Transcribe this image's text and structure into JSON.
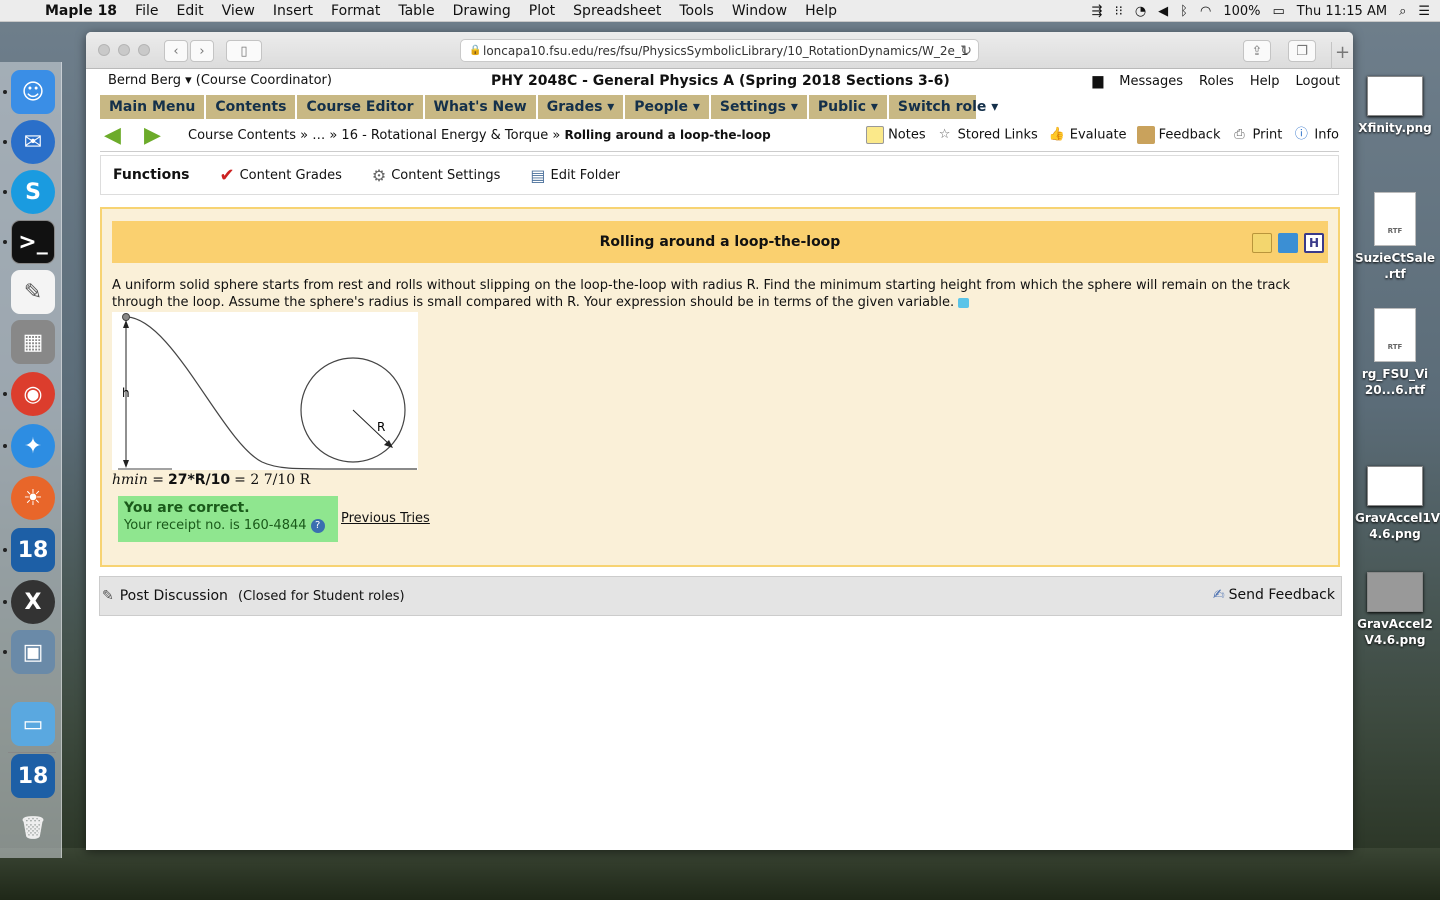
{
  "menubar": {
    "app": "Maple 18",
    "items": [
      "File",
      "Edit",
      "View",
      "Insert",
      "Format",
      "Table",
      "Drawing",
      "Plot",
      "Spreadsheet",
      "Tools",
      "Window",
      "Help"
    ],
    "battery": "100%",
    "clock": "Thu 11:15 AM"
  },
  "desktop": {
    "icons": [
      "Xfinity.png",
      "SuzieCtSale .rtf",
      "rg_FSU_Vi 20...6.rtf",
      "GravAccel1V 4.6.png",
      "GravAccel2 V4.6.png"
    ],
    "doc_label": "RTF"
  },
  "browser": {
    "url": "loncapa10.fsu.edu/res/fsu/PhysicsSymbolicLibrary/10_RotationDynamics/W_2e_1"
  },
  "header": {
    "user": "Bernd Berg",
    "role": "(Course Coordinator)",
    "course": "PHY 2048C - General Physics A (Spring 2018 Sections 3-6)",
    "links": [
      "Messages",
      "Roles",
      "Help",
      "Logout"
    ]
  },
  "mainnav": [
    "Main Menu",
    "Contents",
    "Course Editor",
    "What's New",
    "Grades ▾",
    "People ▾",
    "Settings ▾",
    "Public ▾",
    "Switch role ▾"
  ],
  "breadcrumb": {
    "path": "Course Contents » … » 16 - Rotational Energy & Torque »",
    "current": "Rolling around a loop-the-loop",
    "tools": [
      "Notes",
      "Stored Links",
      "Evaluate",
      "Feedback",
      "Print",
      "Info"
    ]
  },
  "functions": {
    "title": "Functions",
    "items": [
      "Content Grades",
      "Content Settings",
      "Edit Folder"
    ]
  },
  "problem": {
    "title": "Rolling around a loop-the-loop",
    "text_line1": "A uniform solid sphere starts from rest and rolls without slipping on the loop-the-loop with radius R. Find the minimum starting height from which the sphere will remain on the track",
    "text_line2": "through the loop. Assume the sphere's radius is small compared with R. Your expression should be in terms of the given variable.",
    "figure_h": "h",
    "figure_R": "R",
    "answer_label": "hmin =",
    "answer_value": "27*R/10",
    "answer_rendered": "= 2 7/10 R",
    "correct_title": "You are correct.",
    "receipt": "Your receipt no. is 160-4844",
    "previous_tries": "Previous Tries"
  },
  "discussion": {
    "post": "Post Discussion",
    "closed": "(Closed for Student roles)",
    "send_feedback": "Send Feedback"
  }
}
